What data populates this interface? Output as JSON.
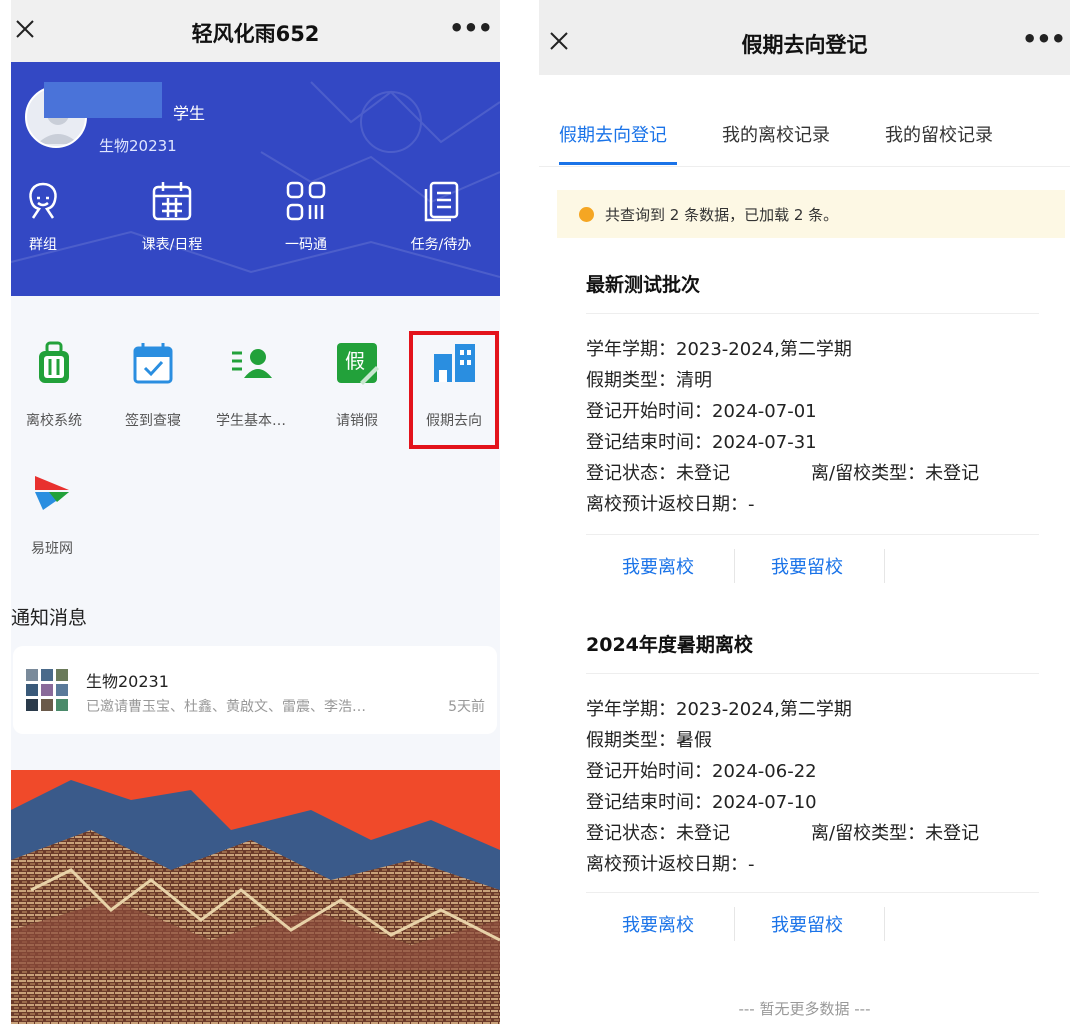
{
  "left": {
    "title": "轻风化雨652",
    "profile": {
      "role": "学生",
      "class": "生物20231"
    },
    "quick_actions": [
      {
        "label": "群组",
        "icon": "group-icon"
      },
      {
        "label": "课表/日程",
        "icon": "calendar-icon"
      },
      {
        "label": "一码通",
        "icon": "qr-code-icon"
      },
      {
        "label": "任务/待办",
        "icon": "task-list-icon"
      }
    ],
    "apps": [
      {
        "label": "离校系统",
        "icon": "luggage-icon",
        "color": "#22a13a"
      },
      {
        "label": "签到查寝",
        "icon": "checkin-calendar-icon",
        "color": "#2a8ee0"
      },
      {
        "label": "学生基本…",
        "icon": "student-profile-icon",
        "color": "#22a13a"
      },
      {
        "label": "请销假",
        "icon": "leave-request-icon",
        "color": "#22a13a"
      },
      {
        "label": "假期去向",
        "icon": "buildings-icon",
        "color": "#2a8ee0"
      },
      {
        "label": "易班网",
        "icon": "yiban-logo-icon",
        "color": "#e8312f"
      }
    ],
    "notice_title": "通知消息",
    "message": {
      "name": "生物20231",
      "preview": "已邀请曹玉宝、杜鑫、黄啟文、雷震、李浩…",
      "time": "5天前"
    },
    "highlight_color": "#e3131b",
    "hero_color": "#3348c4"
  },
  "right": {
    "title": "假期去向登记",
    "tabs": [
      "假期去向登记",
      "我的离校记录",
      "我的留校记录"
    ],
    "active_tab": 0,
    "info": "共查询到 2 条数据，已加载 2 条。",
    "batches": [
      {
        "title": "最新测试批次",
        "semester": "学年学期：2023-2024,第二学期",
        "holiday_type": "假期类型：清明",
        "start": "登记开始时间：2024-07-01",
        "end": "登记结束时间：2024-07-31",
        "status": "登记状态：未登记",
        "stay_type": "离/留校类型：未登记",
        "return_date": "离校预计返校日期：-",
        "leave_btn": "我要离校",
        "stay_btn": "我要留校"
      },
      {
        "title": "2024年度暑期离校",
        "semester": "学年学期：2023-2024,第二学期",
        "holiday_type": "假期类型：暑假",
        "start": "登记开始时间：2024-06-22",
        "end": "登记结束时间：2024-07-10",
        "status": "登记状态：未登记",
        "stay_type": "离/留校类型：未登记",
        "return_date": "离校预计返校日期：-",
        "leave_btn": "我要离校",
        "stay_btn": "我要留校"
      }
    ],
    "no_more": "--- 暂无更多数据 ---",
    "accent_color": "#1a73e8"
  }
}
